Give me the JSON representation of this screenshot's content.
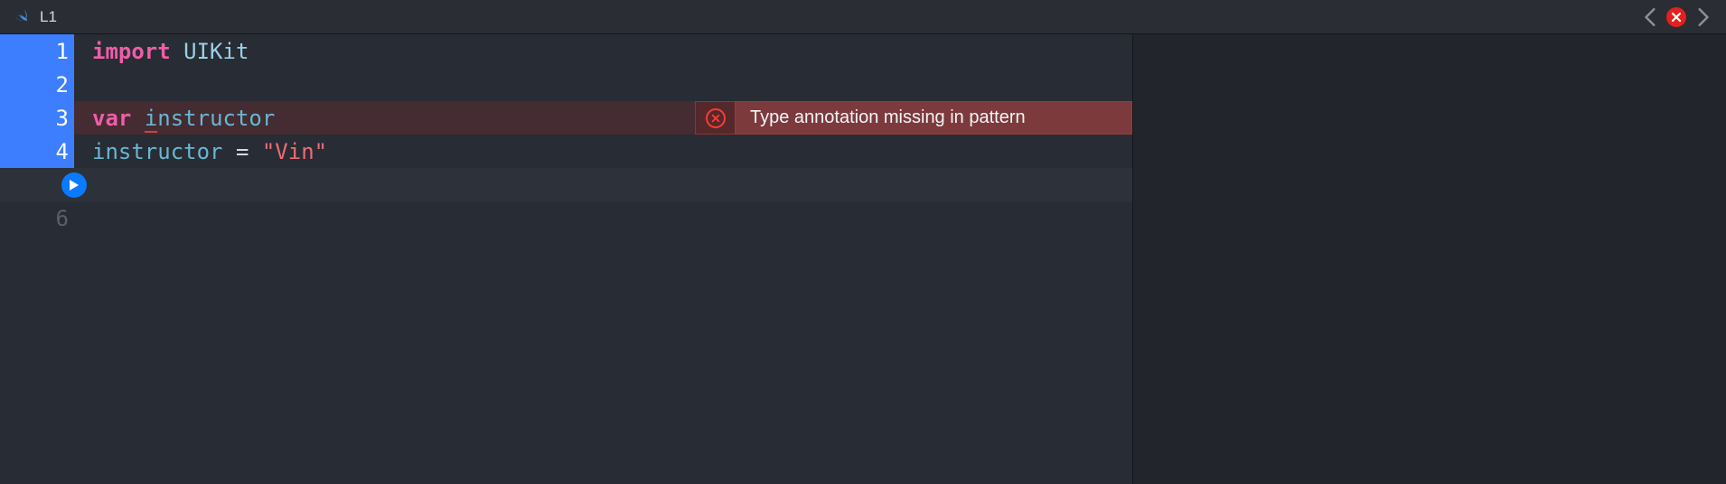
{
  "header": {
    "breadcrumb": "L1"
  },
  "editor": {
    "lines": [
      {
        "num": "1",
        "tokens": [
          {
            "t": "import",
            "c": "tok-keyword"
          },
          {
            "t": " ",
            "c": "tok-plain"
          },
          {
            "t": "UIKit",
            "c": "tok-type"
          }
        ]
      },
      {
        "num": "2",
        "tokens": []
      },
      {
        "num": "3",
        "tokens": [
          {
            "t": "var",
            "c": "tok-keyword"
          },
          {
            "t": " ",
            "c": "tok-plain"
          },
          {
            "t": "i",
            "c": "tok-ident underline-squiggle"
          },
          {
            "t": "nstructor",
            "c": "tok-ident"
          }
        ],
        "error": true
      },
      {
        "num": "4",
        "tokens": [
          {
            "t": "instructor",
            "c": "tok-ident"
          },
          {
            "t": " = ",
            "c": "tok-plain"
          },
          {
            "t": "\"Vin\"",
            "c": "tok-string"
          }
        ]
      },
      {
        "num": "",
        "tokens": []
      },
      {
        "num": "6",
        "tokens": []
      }
    ],
    "active_lines": [
      "1",
      "2",
      "3",
      "4"
    ],
    "error_message": "Type annotation missing in pattern"
  },
  "icons": {
    "swift": "swift-icon",
    "chev_left": "chevron-left-icon",
    "chev_right": "chevron-right-icon",
    "error_close": "error-icon",
    "play": "play-icon"
  },
  "colors": {
    "bg": "#282c34",
    "accent_blue": "#3d7eff",
    "error_red": "#e3201e",
    "keyword_pink": "#ef5da8"
  }
}
